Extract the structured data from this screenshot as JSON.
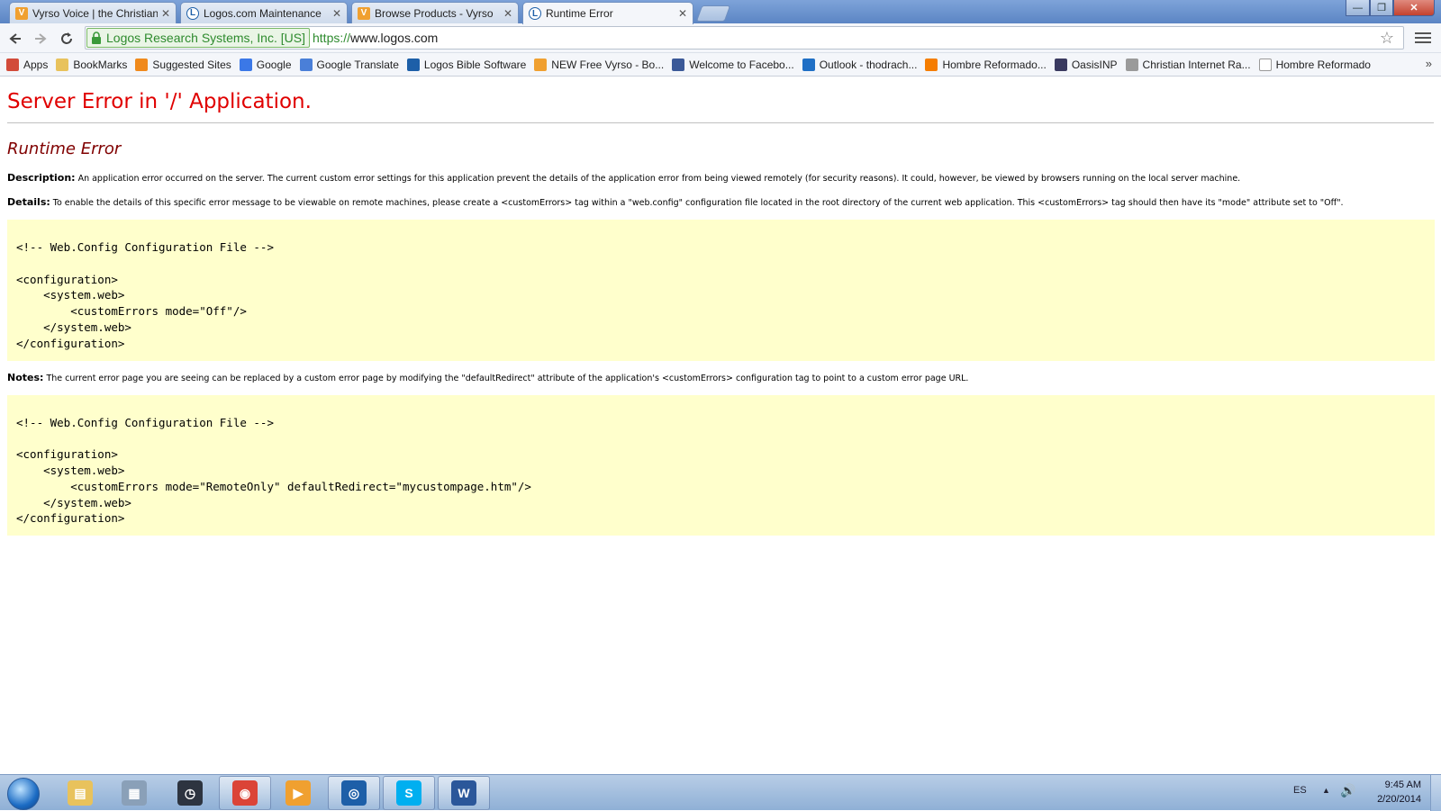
{
  "browser": {
    "tabs": [
      {
        "title": "Vyrso Voice | the Christian",
        "favicon": "vyrso-icon",
        "active": false
      },
      {
        "title": "Logos.com Maintenance",
        "favicon": "logos-icon",
        "active": false
      },
      {
        "title": "Browse Products - Vyrso",
        "favicon": "vyrso-icon",
        "active": false
      },
      {
        "title": "Runtime Error",
        "favicon": "logos-icon",
        "active": true
      }
    ],
    "close_glyph": "✕",
    "window_controls": {
      "minimize": "—",
      "maximize": "❐",
      "close": "✕"
    },
    "ev_cert": "Logos Research Systems, Inc. [US]",
    "url_scheme": "https://",
    "url_host": "www.logos.com",
    "bookmarks": [
      {
        "label": "Apps",
        "icon": "apps-icon",
        "color": "#d24b3a"
      },
      {
        "label": "BookMarks",
        "icon": "folder-icon",
        "color": "#e8c25c"
      },
      {
        "label": "Suggested Sites",
        "icon": "suggested-sites-icon",
        "color": "#f08a1c"
      },
      {
        "label": "Google",
        "icon": "google-icon",
        "color": "#3b78e7"
      },
      {
        "label": "Google Translate",
        "icon": "translate-icon",
        "color": "#4a7fd8"
      },
      {
        "label": "Logos Bible Software",
        "icon": "logos-icon",
        "color": "#1d5fa8"
      },
      {
        "label": "NEW Free Vyrso - Bo...",
        "icon": "vyrso-icon",
        "color": "#f0a030"
      },
      {
        "label": "Welcome to Facebo...",
        "icon": "facebook-icon",
        "color": "#3b5998"
      },
      {
        "label": "Outlook - thodrach...",
        "icon": "outlook-icon",
        "color": "#1f6fc5"
      },
      {
        "label": "Hombre Reformado...",
        "icon": "blogger-icon",
        "color": "#f57d00"
      },
      {
        "label": "OasisINP",
        "icon": "oasis-icon",
        "color": "#3a3a60"
      },
      {
        "label": "Christian Internet Ra...",
        "icon": "radio-icon",
        "color": "#9a9a9a"
      },
      {
        "label": "Hombre Reformado",
        "icon": "page-icon",
        "color": "#ffffff"
      }
    ],
    "bookmarks_overflow": "»"
  },
  "page": {
    "server_title": "Server Error in '/' Application.",
    "error_title": "Runtime Error",
    "description_label": "Description:",
    "description_text": " An application error occurred on the server. The current custom error settings for this application prevent the details of the application error from being viewed remotely (for security reasons). It could, however, be viewed by browsers running on the local server machine.",
    "details_label": "Details:",
    "details_text": " To enable the details of this specific error message to be viewable on remote machines, please create a <customErrors> tag within a \"web.config\" configuration file located in the root directory of the current web application. This <customErrors> tag should then have its \"mode\" attribute set to \"Off\".",
    "code1": "<!-- Web.Config Configuration File -->\n\n<configuration>\n    <system.web>\n        <customErrors mode=\"Off\"/>\n    </system.web>\n</configuration>",
    "notes_label": "Notes:",
    "notes_text": " The current error page you are seeing can be replaced by a custom error page by modifying the \"defaultRedirect\" attribute of the application's <customErrors> configuration tag to point to a custom error page URL.",
    "code2": "<!-- Web.Config Configuration File -->\n\n<configuration>\n    <system.web>\n        <customErrors mode=\"RemoteOnly\" defaultRedirect=\"mycustompage.htm\"/>\n    </system.web>\n</configuration>"
  },
  "taskbar": {
    "apps": [
      {
        "name": "windows-explorer-icon",
        "color": "#e8c25c",
        "glyph": "▤",
        "pinned": false
      },
      {
        "name": "calculator-icon",
        "color": "#8aa0b8",
        "glyph": "▦",
        "pinned": false
      },
      {
        "name": "clock-app-icon",
        "color": "#2d3440",
        "glyph": "◷",
        "pinned": false
      },
      {
        "name": "chrome-icon",
        "color": "#db4437",
        "glyph": "◉",
        "pinned": true
      },
      {
        "name": "media-player-icon",
        "color": "#f0a030",
        "glyph": "▶",
        "pinned": false
      },
      {
        "name": "logos-app-icon",
        "color": "#1d5fa8",
        "glyph": "◎",
        "pinned": true
      },
      {
        "name": "skype-icon",
        "color": "#00aff0",
        "glyph": "S",
        "pinned": true
      },
      {
        "name": "word-icon",
        "color": "#2b579a",
        "glyph": "W",
        "pinned": true
      }
    ],
    "language": "ES",
    "tray_arrow": "▲",
    "volume_glyph": "🔊",
    "time": "9:45 AM",
    "date": "2/20/2014"
  }
}
